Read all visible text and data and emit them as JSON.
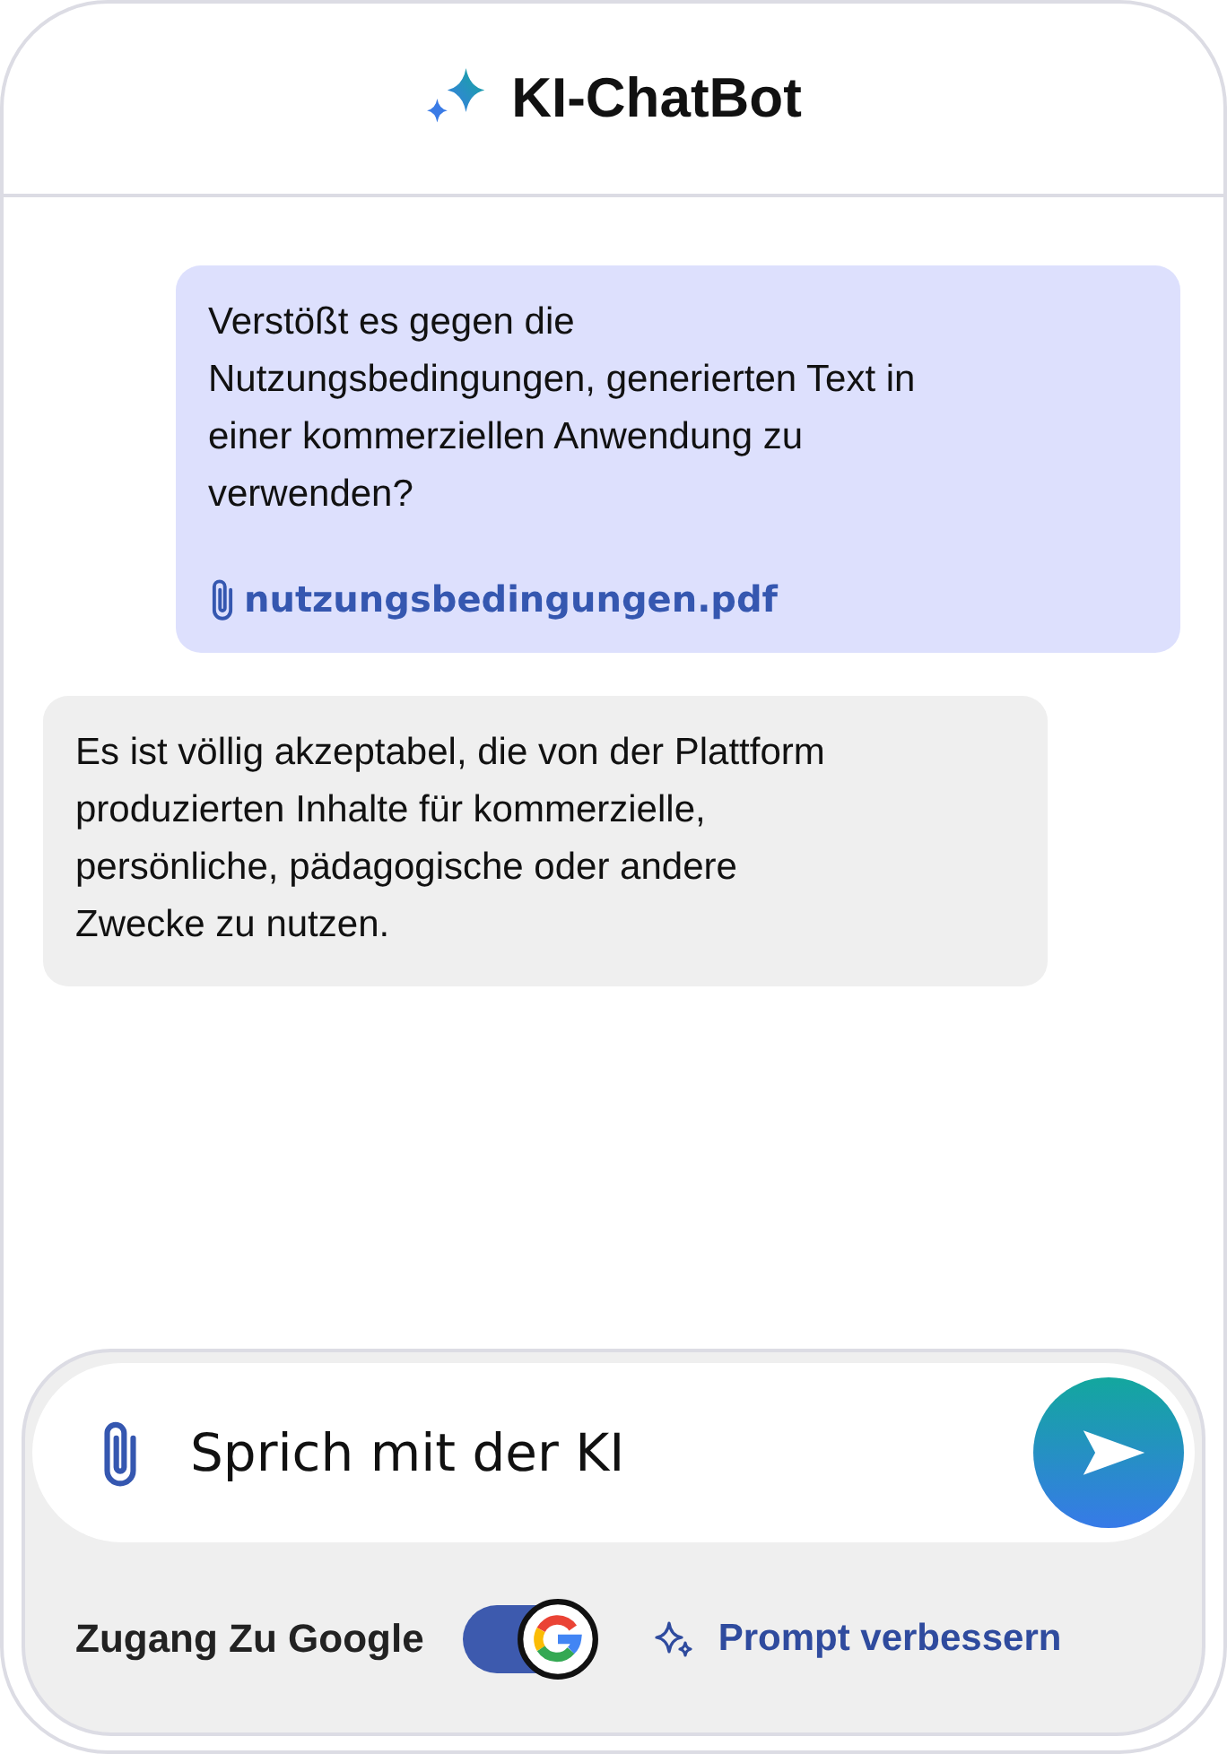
{
  "header": {
    "title": "KI-ChatBot"
  },
  "messages": [
    {
      "kind": "user",
      "text": "Verstößt es gegen die Nutzungsbedingungen, generierten Text in einer kommerziellen Anwendung zu verwenden?",
      "attachment": "nutzungsbedingungen.pdf"
    },
    {
      "kind": "bot",
      "text": "Es ist völlig akzeptabel, die von der Plattform produzierten Inhalte für kommerzielle, persönliche, pädagogische oder andere Zwecke zu nutzen."
    }
  ],
  "composer": {
    "placeholder": "Sprich mit der KI",
    "google_access": {
      "label": "Zugang Zu Google",
      "on": true
    },
    "improve_prompt": "Prompt verbessern"
  }
}
